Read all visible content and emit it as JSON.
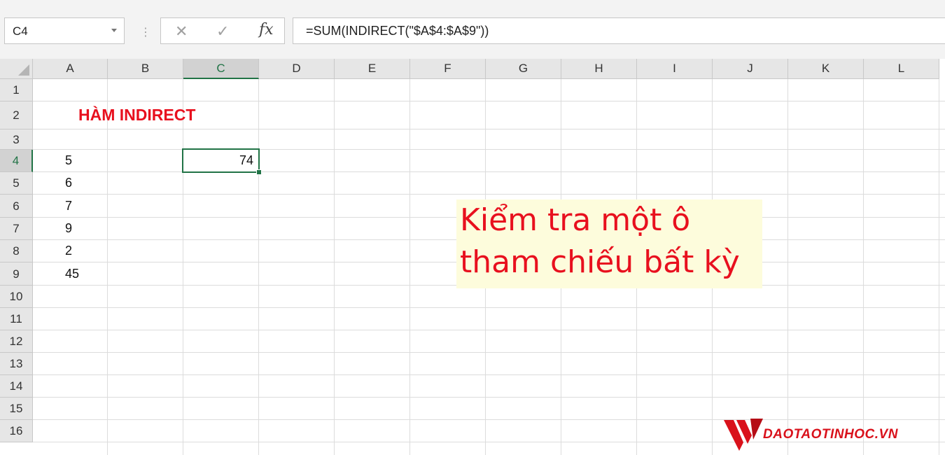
{
  "formula_bar": {
    "name_box": "C4",
    "formula": "=SUM(INDIRECT(\"$A$4:$A$9\"))",
    "cancel_symbol": "✕",
    "enter_symbol": "✓",
    "fx_symbol": "fx"
  },
  "columns": [
    "A",
    "B",
    "C",
    "D",
    "E",
    "F",
    "G",
    "H",
    "I",
    "J",
    "K",
    "L"
  ],
  "rows": [
    "1",
    "2",
    "3",
    "4",
    "5",
    "6",
    "7",
    "8",
    "9",
    "10",
    "11",
    "12",
    "13",
    "14",
    "15",
    "16"
  ],
  "selected_cell": {
    "column": "C",
    "row": "4"
  },
  "cells": {
    "B2": "HÀM INDIRECT",
    "A4": "5",
    "A5": "6",
    "A6": "7",
    "A7": "9",
    "A8": "2",
    "A9": "45",
    "C4": "74"
  },
  "callout": {
    "line1": "Kiểm tra một ô",
    "line2": "tham chiếu bất kỳ"
  },
  "watermark": {
    "text": "DAOTAOTINHOC.VN"
  },
  "colors": {
    "accent_green": "#217346",
    "title_red": "#e8101e",
    "callout_bg": "#fdfcdc"
  }
}
